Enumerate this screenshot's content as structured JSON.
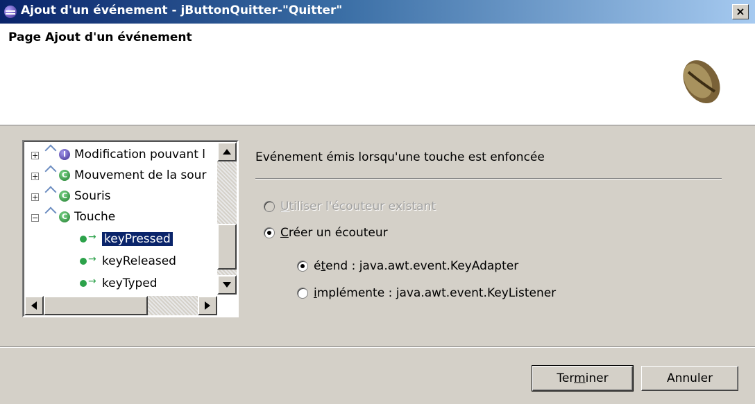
{
  "window": {
    "title": "Ajout d'un événement - jButtonQuitter-\"Quitter\"",
    "close_label": "×"
  },
  "header": {
    "title": "Page Ajout d'un événement"
  },
  "tree": {
    "items": [
      {
        "label": "Modification pouvant l",
        "icon": "interface-icon",
        "expanded": false
      },
      {
        "label": "Mouvement de la sour",
        "icon": "class-icon",
        "expanded": false
      },
      {
        "label": "Souris",
        "icon": "class-icon",
        "expanded": false
      },
      {
        "label": "Touche",
        "icon": "class-icon",
        "expanded": true
      }
    ],
    "methods": [
      {
        "label": "keyPressed",
        "selected": true
      },
      {
        "label": "keyReleased",
        "selected": false
      },
      {
        "label": "keyTyped",
        "selected": false
      }
    ]
  },
  "details": {
    "description": "Evénement émis lorsqu'une touche est enfoncée",
    "option_existing": {
      "prefix": "",
      "mnemonic": "U",
      "rest": "tiliser l'écouteur existant",
      "checked": false,
      "enabled": false
    },
    "option_create": {
      "prefix": "",
      "mnemonic": "C",
      "rest": "réer un écouteur",
      "checked": true,
      "enabled": true
    },
    "option_extends": {
      "prefix": "é",
      "mnemonic": "t",
      "rest": "end : java.awt.event.KeyAdapter",
      "checked": true
    },
    "option_implements": {
      "prefix": "",
      "mnemonic": "i",
      "rest": "mplémente : java.awt.event.KeyListener",
      "checked": false
    }
  },
  "buttons": {
    "finish": {
      "prefix": "Ter",
      "mnemonic": "m",
      "rest": "iner"
    },
    "cancel": "Annuler"
  }
}
